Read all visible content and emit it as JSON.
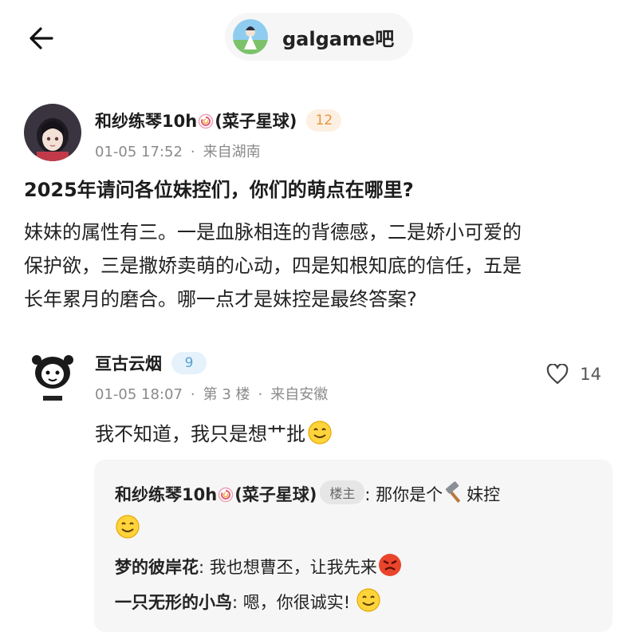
{
  "header": {
    "back_icon": "arrow-left-icon",
    "forum_name": "galgame吧"
  },
  "op": {
    "username": "和纱练琴10h",
    "username_suffix": "(菜子星球)",
    "level": "12",
    "date": "01-05 17:52",
    "location": "来自湖南",
    "title": "2025年请问各位妹控们，你们的萌点在哪里?",
    "body_lines": [
      "妹妹的属性有三。一是血脉相连的背德感，二是娇小可爱的",
      "保护欲，三是撒娇卖萌的心动，四是知根知底的信任，五是",
      "长年累月的磨合。哪一点才是妹控是最终答案?"
    ]
  },
  "reply": {
    "username": "亘古云烟",
    "level": "9",
    "date": "01-05 18:07",
    "floor": "第 3 楼",
    "location": "来自安徽",
    "like_count": "14",
    "text": "我不知道，我只是想艹批",
    "sub_replies": [
      {
        "author": "和纱练琴10h",
        "author_suffix": "(菜子星球)",
        "tag": "楼主",
        "text_before": ": 那你是个",
        "text_after": "妹控"
      },
      {
        "author": "梦的彼岸花",
        "text": ": 我也想曹丕，让我先来"
      },
      {
        "author": "一只无形的小鸟",
        "text": ": 嗯，你很诚实!"
      }
    ]
  },
  "colors": {
    "level_orange": "#e8963e",
    "level_blue": "#5a9fd4",
    "meta_gray": "#8a8a8a",
    "sub_bg": "#f6f6f6"
  }
}
